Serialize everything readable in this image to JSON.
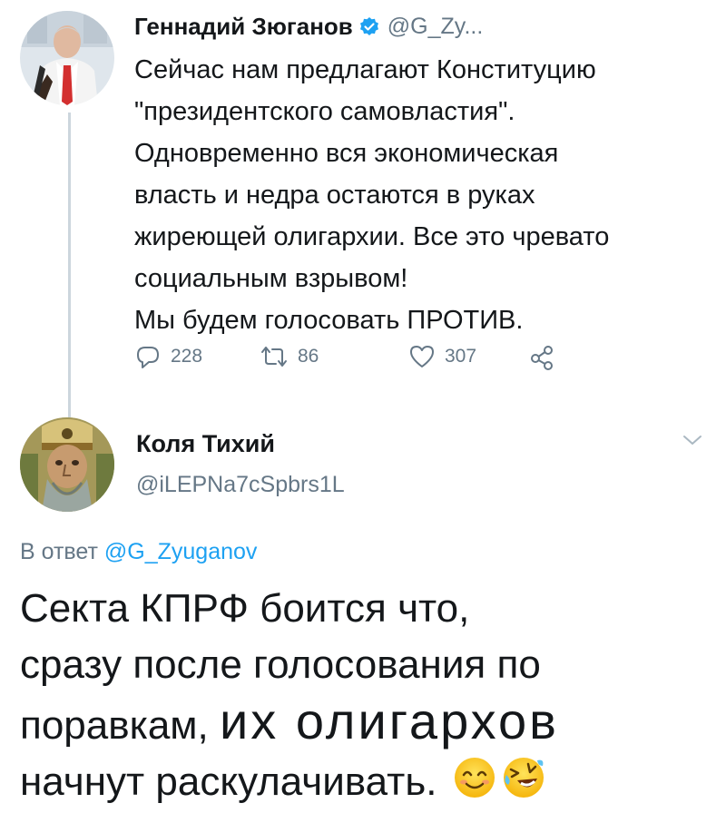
{
  "tweet1": {
    "author_name": "Геннадий Зюганов",
    "handle": "@G_Zy...",
    "verified": true,
    "text_lines": [
      "Сейчас нам предлагают Конституцию",
      "\"президентского самовластия\".",
      "Одновременно вся экономическая",
      "власть и недра остаются в руках",
      "жиреющей олигархии. Все это чревато",
      "социальным взрывом!",
      "Мы будем голосовать ПРОТИВ."
    ],
    "actions": {
      "replies": "228",
      "retweets": "86",
      "likes": "307"
    }
  },
  "tweet2": {
    "author_name": "Коля Тихий",
    "handle": "@iLEPNa7cSpbrs1L",
    "in_reply_prefix": "В ответ",
    "in_reply_to": "@G_Zyuganov",
    "text_lines": [
      "Секта КПРФ боится что,",
      "сразу после голосования по",
      "поравкам,",
      "их олигархов",
      "начнут раскулачивать."
    ],
    "emojis": [
      "smiling-face-icon",
      "rolling-laughing-face-icon"
    ]
  },
  "colors": {
    "text": "#14171a",
    "secondary": "#657786",
    "link": "#1da1f2",
    "thread_line": "#ccd6dd"
  }
}
